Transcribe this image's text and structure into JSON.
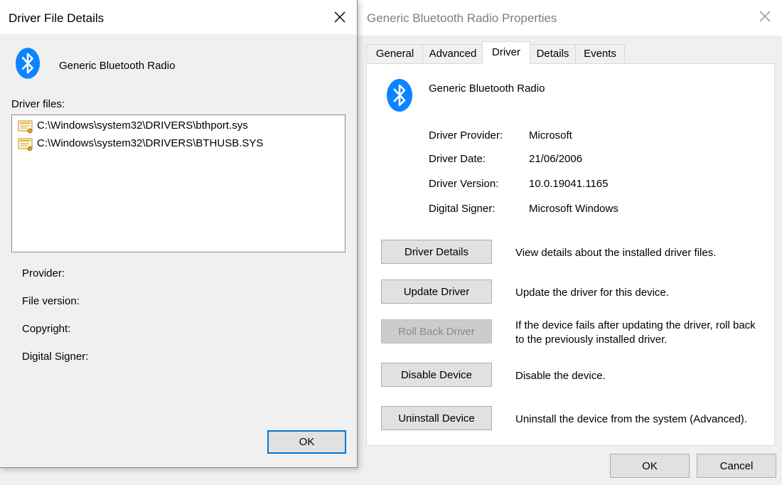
{
  "properties_window": {
    "title": "Generic Bluetooth Radio Properties",
    "tabs": [
      {
        "label": "General"
      },
      {
        "label": "Advanced"
      },
      {
        "label": "Driver"
      },
      {
        "label": "Details"
      },
      {
        "label": "Events"
      }
    ],
    "active_tab": "Driver",
    "device_name": "Generic Bluetooth Radio",
    "fields": [
      {
        "label": "Driver Provider:",
        "value": "Microsoft"
      },
      {
        "label": "Driver Date:",
        "value": "21/06/2006"
      },
      {
        "label": "Driver Version:",
        "value": "10.0.19041.1165"
      },
      {
        "label": "Digital Signer:",
        "value": "Microsoft Windows"
      }
    ],
    "actions": [
      {
        "button": "Driver Details",
        "description": "View details about the installed driver files."
      },
      {
        "button": "Update Driver",
        "description": "Update the driver for this device."
      },
      {
        "button": "Roll Back Driver",
        "description": "If the device fails after updating the driver, roll back to the previously installed driver."
      },
      {
        "button": "Disable Device",
        "description": "Disable the device."
      },
      {
        "button": "Uninstall Device",
        "description": "Uninstall the device from the system (Advanced)."
      }
    ],
    "ok_label": "OK",
    "cancel_label": "Cancel"
  },
  "details_window": {
    "title": "Driver File Details",
    "device_name": "Generic Bluetooth Radio",
    "driver_files_label": "Driver files:",
    "files": [
      {
        "path": "C:\\Windows\\system32\\DRIVERS\\bthport.sys"
      },
      {
        "path": "C:\\Windows\\system32\\DRIVERS\\BTHUSB.SYS"
      }
    ],
    "info_labels": {
      "provider": "Provider:",
      "file_version": "File version:",
      "copyright": "Copyright:",
      "digital_signer": "Digital Signer:"
    },
    "ok_label": "OK"
  },
  "icons": {
    "bluetooth": "bluetooth-icon",
    "driver_file": "driver-file-icon",
    "close": "close-icon"
  },
  "colors": {
    "bluetooth_blue": "#0a84ff",
    "focus_blue": "#0078d7",
    "disabled_text": "#8a8a8a"
  }
}
